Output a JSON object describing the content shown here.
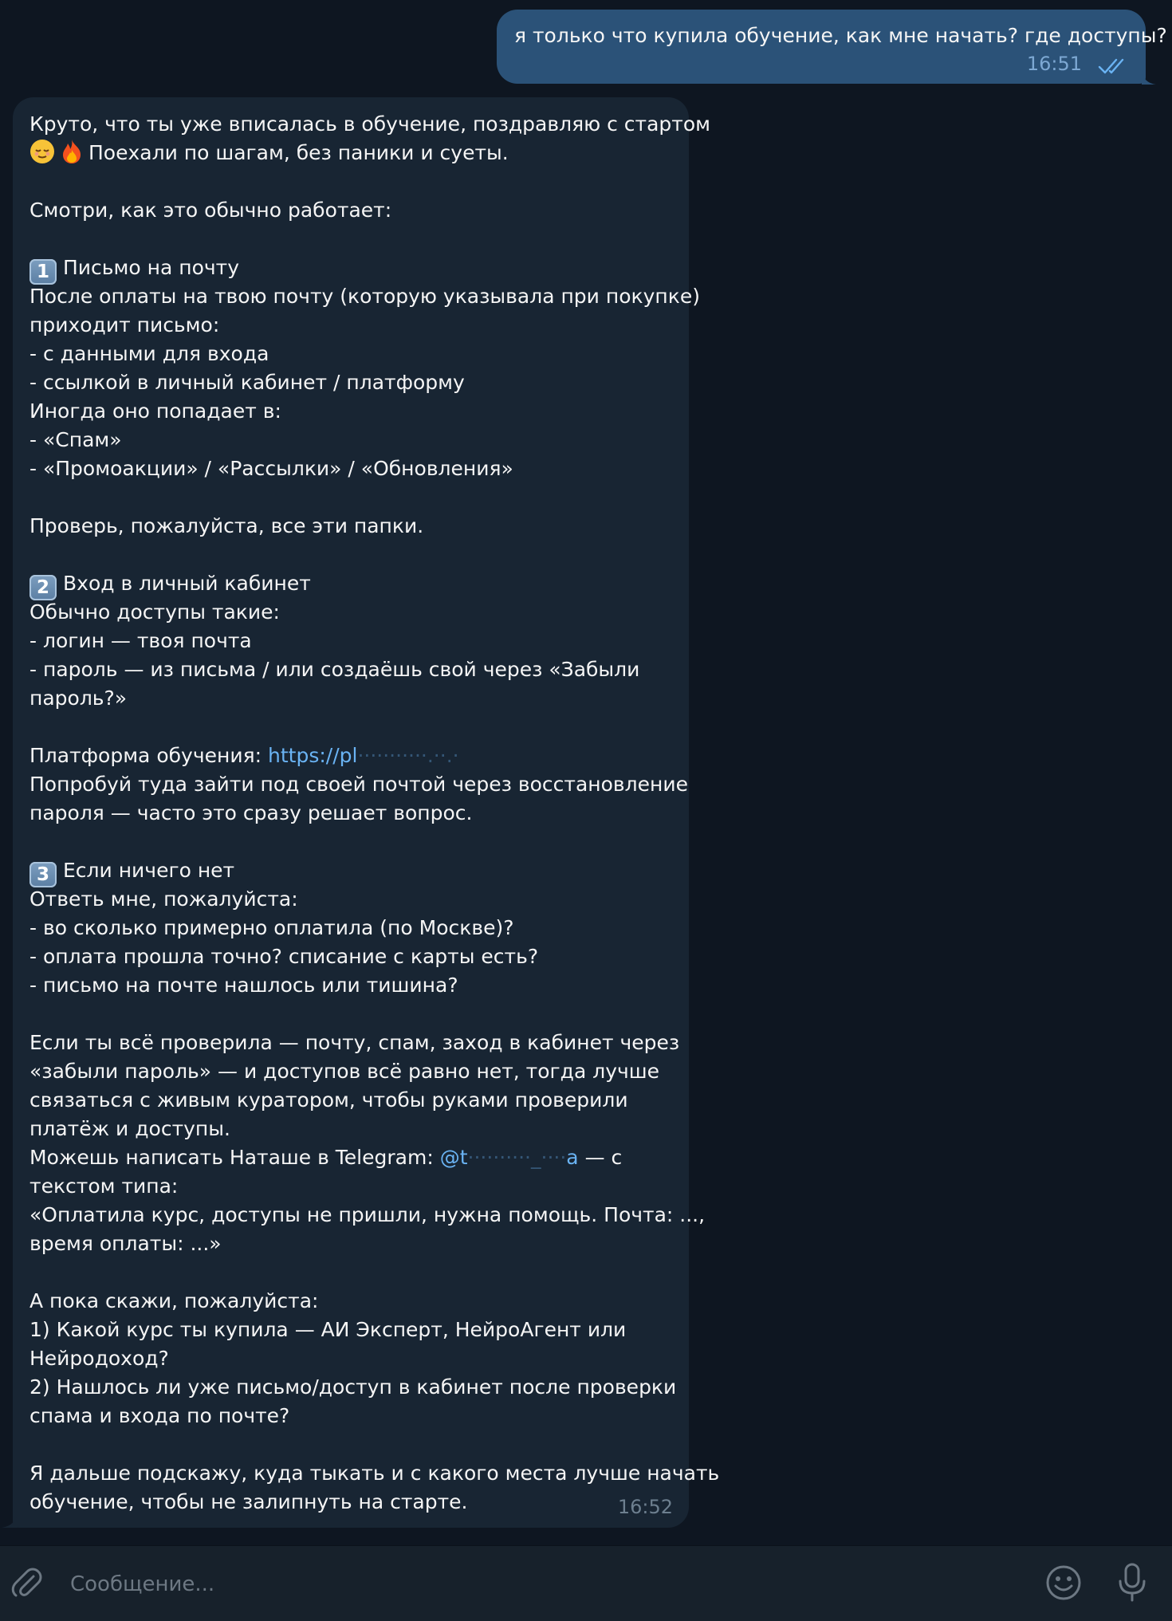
{
  "outgoing": {
    "text": "я только что купила обучение, как мне начать? где доступы?",
    "time": "16:51"
  },
  "incoming": {
    "time": "16:52",
    "lines": {
      "l1": "Круто, что ты уже вписалась в обучение, поздравляю с стартом",
      "l2_emoji1": "😌",
      "l2_emoji2": "🔥",
      "l2": "Поехали по шагам, без паники и суеты.",
      "l3": "Смотри, как это обычно работает:",
      "s1_num": "1",
      "s1_title": "Письмо на почту",
      "s1_a": "После оплаты на твою почту (которую указывала при покупке)",
      "s1_b": "приходит письмо:",
      "s1_c": "- с данными для входа",
      "s1_d": "- ссылкой в личный кабинет / платформу",
      "s1_e": "Иногда оно попадает в:",
      "s1_f": "- «Спам»",
      "s1_g": "- «Промоакции» / «Рассылки» / «Обновления»",
      "s1_h": "Проверь, пожалуйста, все эти папки.",
      "s2_num": "2",
      "s2_title": "Вход в личный кабинет",
      "s2_a": "Обычно доступы такие:",
      "s2_b": "- логин — твоя почта",
      "s2_c": "- пароль — из письма / или создаёшь свой через «Забыли",
      "s2_d": "пароль?»",
      "s2_platform_label": "Платформа обучения:",
      "s2_platform_link": "https://pl",
      "s2_e": "Попробуй туда зайти под своей почтой через восстановление",
      "s2_f": "пароля — часто это сразу решает вопрос.",
      "s3_num": "3",
      "s3_title": "Если ничего нет",
      "s3_a": "Ответь мне, пожалуйста:",
      "s3_b": "- во сколько примерно оплатила (по Москве)?",
      "s3_c": "- оплата прошла точно? списание с карты есть?",
      "s3_d": "- письмо на почте нашлось или тишина?",
      "p1_a": "Если ты всё проверила — почту, спам, заход в кабинет через",
      "p1_b": "«забыли пароль» — и доступов всё равно нет, тогда лучше",
      "p1_c": "связаться с живым куратором, чтобы руками проверили",
      "p1_d": "платёж и доступы.",
      "p1_e_label": "Можешь написать Наташе в Telegram:",
      "p1_e_handle_start": "@t",
      "p1_e_handle_end": "a",
      "p1_e_tail": "— с",
      "p1_f": "текстом типа:",
      "p1_g": "«Оплатила курс, доступы не пришли, нужна помощь. Почта: ...,",
      "p1_h": "время оплаты: ...»",
      "p2_a": "А пока скажи, пожалуйста:",
      "p2_b": "1) Какой курс ты купила — АИ Эксперт, НейроАгент или",
      "p2_c": "Нейродоход?",
      "p2_d": "2) Нашлось ли уже письмо/доступ в кабинет после проверки",
      "p2_e": "спама и входа по почте?",
      "p3_a": "Я дальше подскажу, куда тыкать и с какого места лучше начать",
      "p3_b": "обучение, чтобы не залипнуть на старте."
    }
  },
  "composer": {
    "placeholder": "Сообщение..."
  },
  "icons": {
    "attach": "paperclip-icon",
    "emoji": "smiley-icon",
    "mic": "microphone-icon",
    "read": "double-check-icon"
  },
  "colors": {
    "background": "#0e1621",
    "outgoing_bubble": "#2b5278",
    "incoming_bubble": "#182533",
    "link": "#6ab3f3",
    "composer": "#17212b"
  }
}
